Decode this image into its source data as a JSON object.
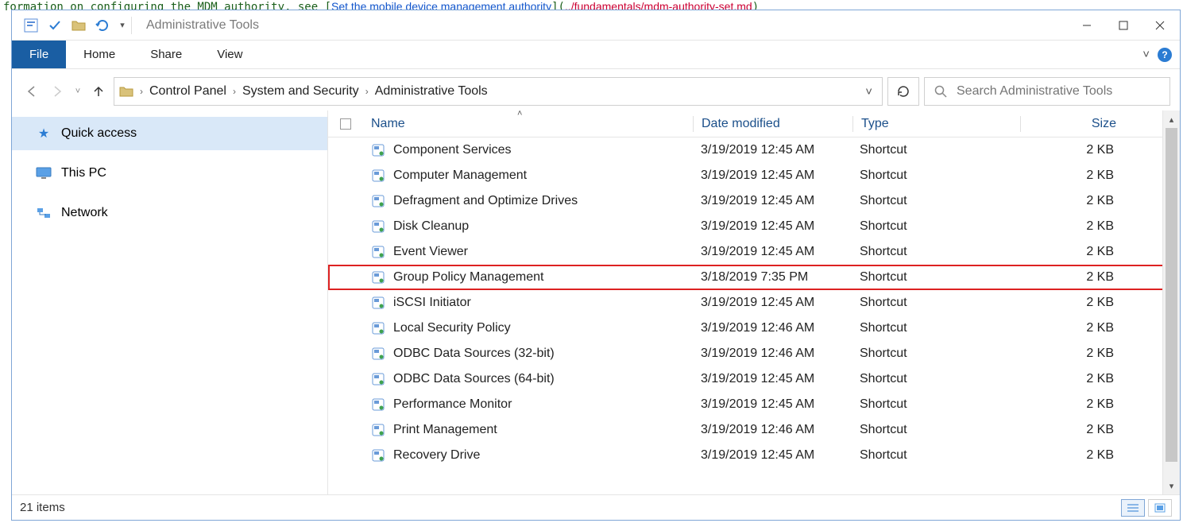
{
  "titlebar": {
    "title": "Administrative Tools"
  },
  "menu": {
    "file": "File",
    "home": "Home",
    "share": "Share",
    "view": "View"
  },
  "breadcrumbs": [
    "Control Panel",
    "System and Security",
    "Administrative Tools"
  ],
  "search": {
    "placeholder": "Search Administrative Tools"
  },
  "sidebar": {
    "items": [
      {
        "label": "Quick access"
      },
      {
        "label": "This PC"
      },
      {
        "label": "Network"
      }
    ]
  },
  "columns": {
    "name": "Name",
    "date": "Date modified",
    "type": "Type",
    "size": "Size"
  },
  "files": [
    {
      "name": "Component Services",
      "date": "3/19/2019 12:45 AM",
      "type": "Shortcut",
      "size": "2 KB",
      "hl": false
    },
    {
      "name": "Computer Management",
      "date": "3/19/2019 12:45 AM",
      "type": "Shortcut",
      "size": "2 KB",
      "hl": false
    },
    {
      "name": "Defragment and Optimize Drives",
      "date": "3/19/2019 12:45 AM",
      "type": "Shortcut",
      "size": "2 KB",
      "hl": false
    },
    {
      "name": "Disk Cleanup",
      "date": "3/19/2019 12:45 AM",
      "type": "Shortcut",
      "size": "2 KB",
      "hl": false
    },
    {
      "name": "Event Viewer",
      "date": "3/19/2019 12:45 AM",
      "type": "Shortcut",
      "size": "2 KB",
      "hl": false
    },
    {
      "name": "Group Policy Management",
      "date": "3/18/2019 7:35 PM",
      "type": "Shortcut",
      "size": "2 KB",
      "hl": true
    },
    {
      "name": "iSCSI Initiator",
      "date": "3/19/2019 12:45 AM",
      "type": "Shortcut",
      "size": "2 KB",
      "hl": false
    },
    {
      "name": "Local Security Policy",
      "date": "3/19/2019 12:46 AM",
      "type": "Shortcut",
      "size": "2 KB",
      "hl": false
    },
    {
      "name": "ODBC Data Sources (32-bit)",
      "date": "3/19/2019 12:46 AM",
      "type": "Shortcut",
      "size": "2 KB",
      "hl": false
    },
    {
      "name": "ODBC Data Sources (64-bit)",
      "date": "3/19/2019 12:45 AM",
      "type": "Shortcut",
      "size": "2 KB",
      "hl": false
    },
    {
      "name": "Performance Monitor",
      "date": "3/19/2019 12:45 AM",
      "type": "Shortcut",
      "size": "2 KB",
      "hl": false
    },
    {
      "name": "Print Management",
      "date": "3/19/2019 12:46 AM",
      "type": "Shortcut",
      "size": "2 KB",
      "hl": false
    },
    {
      "name": "Recovery Drive",
      "date": "3/19/2019 12:45 AM",
      "type": "Shortcut",
      "size": "2 KB",
      "hl": false
    }
  ],
  "status": {
    "text": "21 items"
  },
  "colors": {
    "accent": "#1a5ea3",
    "highlight_border": "#d22"
  }
}
